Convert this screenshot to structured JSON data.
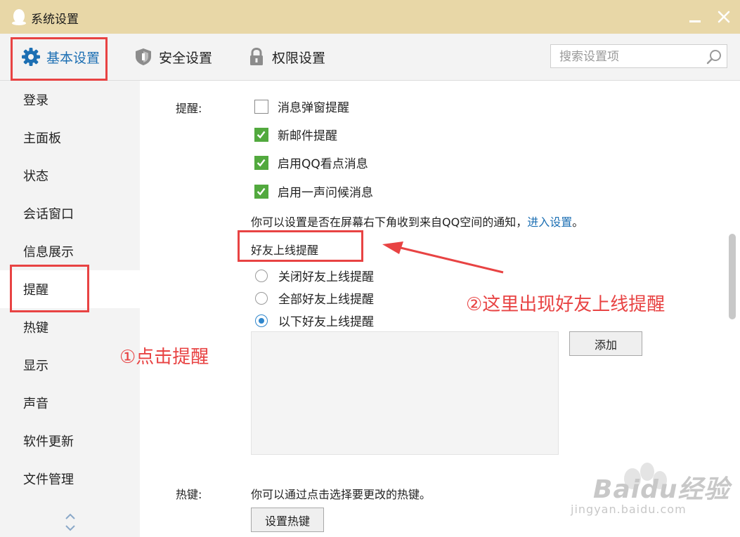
{
  "window": {
    "title": "系统设置"
  },
  "tabs": [
    {
      "label": "基本设置",
      "icon": "gear-icon",
      "active": true
    },
    {
      "label": "安全设置",
      "icon": "shield-icon",
      "active": false
    },
    {
      "label": "权限设置",
      "icon": "lock-icon",
      "active": false
    }
  ],
  "search": {
    "placeholder": "搜索设置项",
    "value": ""
  },
  "sidebar": {
    "items": [
      {
        "label": "登录"
      },
      {
        "label": "主面板"
      },
      {
        "label": "状态"
      },
      {
        "label": "会话窗口"
      },
      {
        "label": "信息展示"
      },
      {
        "label": "提醒",
        "active": true
      },
      {
        "label": "热键"
      },
      {
        "label": "显示"
      },
      {
        "label": "声音"
      },
      {
        "label": "软件更新"
      },
      {
        "label": "文件管理"
      }
    ]
  },
  "reminder": {
    "label": "提醒:",
    "options": [
      {
        "label": "消息弹窗提醒",
        "checked": false
      },
      {
        "label": "新邮件提醒",
        "checked": true
      },
      {
        "label": "启用QQ看点消息",
        "checked": true
      },
      {
        "label": "启用一声问候消息",
        "checked": true
      }
    ],
    "info_text": "你可以设置是否在屏幕右下角收到来自QQ空间的通知，",
    "info_link": "进入设置",
    "info_end": "。"
  },
  "friend_online": {
    "title": "好友上线提醒",
    "radios": [
      {
        "label": "关闭好友上线提醒",
        "checked": false
      },
      {
        "label": "全部好友上线提醒",
        "checked": false
      },
      {
        "label": "以下好友上线提醒",
        "checked": true
      }
    ],
    "add_button": "添加"
  },
  "hotkey": {
    "label": "热键:",
    "info": "你可以通过点击选择要更改的热键。",
    "button": "设置热键"
  },
  "annotations": {
    "step1": "①点击提醒",
    "step2": "②这里出现好友上线提醒",
    "color": "#e84343"
  },
  "watermark": {
    "brand": "Baidu经验",
    "url": "jingyan.baidu.com"
  },
  "colors": {
    "titlebar": "#e8d7a7",
    "accent": "#1c6fb3",
    "checkbox": "#52a93e",
    "radio": "#2f86cc"
  }
}
